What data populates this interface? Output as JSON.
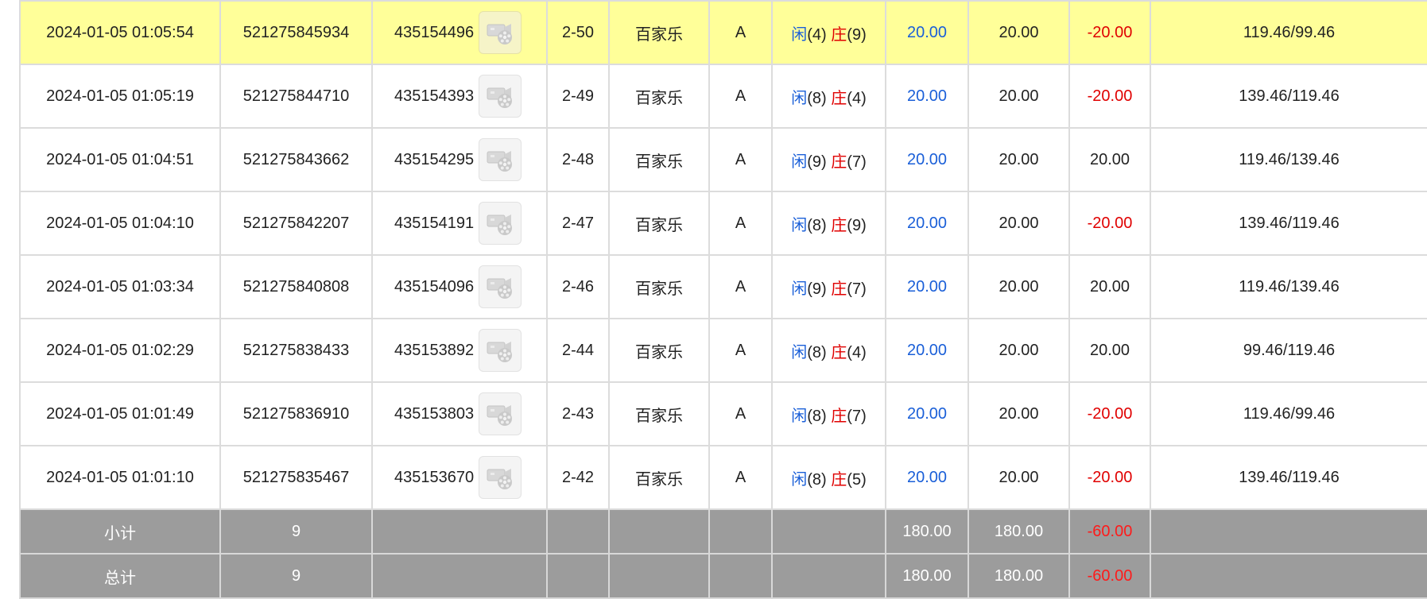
{
  "table": {
    "rows": [
      {
        "time": "2024-01-05 01:05:54",
        "order_id": "521275845934",
        "round_id": "435154496",
        "table_no": "2-50",
        "game": "百家乐",
        "type": "A",
        "player_label": "闲",
        "player_points": "(4)",
        "banker_label": "庄",
        "banker_points": "(9)",
        "bet": "20.00",
        "valid_bet": "20.00",
        "win_loss": "-20.00",
        "win_loss_color": "red",
        "balance": "119.46/99.46",
        "highlighted": true
      },
      {
        "time": "2024-01-05 01:05:19",
        "order_id": "521275844710",
        "round_id": "435154393",
        "table_no": "2-49",
        "game": "百家乐",
        "type": "A",
        "player_label": "闲",
        "player_points": "(8)",
        "banker_label": "庄",
        "banker_points": "(4)",
        "bet": "20.00",
        "valid_bet": "20.00",
        "win_loss": "-20.00",
        "win_loss_color": "red",
        "balance": "139.46/119.46",
        "highlighted": false
      },
      {
        "time": "2024-01-05 01:04:51",
        "order_id": "521275843662",
        "round_id": "435154295",
        "table_no": "2-48",
        "game": "百家乐",
        "type": "A",
        "player_label": "闲",
        "player_points": "(9)",
        "banker_label": "庄",
        "banker_points": "(7)",
        "bet": "20.00",
        "valid_bet": "20.00",
        "win_loss": "20.00",
        "win_loss_color": "black",
        "balance": "119.46/139.46",
        "highlighted": false
      },
      {
        "time": "2024-01-05 01:04:10",
        "order_id": "521275842207",
        "round_id": "435154191",
        "table_no": "2-47",
        "game": "百家乐",
        "type": "A",
        "player_label": "闲",
        "player_points": "(8)",
        "banker_label": "庄",
        "banker_points": "(9)",
        "bet": "20.00",
        "valid_bet": "20.00",
        "win_loss": "-20.00",
        "win_loss_color": "red",
        "balance": "139.46/119.46",
        "highlighted": false
      },
      {
        "time": "2024-01-05 01:03:34",
        "order_id": "521275840808",
        "round_id": "435154096",
        "table_no": "2-46",
        "game": "百家乐",
        "type": "A",
        "player_label": "闲",
        "player_points": "(9)",
        "banker_label": "庄",
        "banker_points": "(7)",
        "bet": "20.00",
        "valid_bet": "20.00",
        "win_loss": "20.00",
        "win_loss_color": "black",
        "balance": "119.46/139.46",
        "highlighted": false
      },
      {
        "time": "2024-01-05 01:02:29",
        "order_id": "521275838433",
        "round_id": "435153892",
        "table_no": "2-44",
        "game": "百家乐",
        "type": "A",
        "player_label": "闲",
        "player_points": "(8)",
        "banker_label": "庄",
        "banker_points": "(4)",
        "bet": "20.00",
        "valid_bet": "20.00",
        "win_loss": "20.00",
        "win_loss_color": "black",
        "balance": "99.46/119.46",
        "highlighted": false
      },
      {
        "time": "2024-01-05 01:01:49",
        "order_id": "521275836910",
        "round_id": "435153803",
        "table_no": "2-43",
        "game": "百家乐",
        "type": "A",
        "player_label": "闲",
        "player_points": "(8)",
        "banker_label": "庄",
        "banker_points": "(7)",
        "bet": "20.00",
        "valid_bet": "20.00",
        "win_loss": "-20.00",
        "win_loss_color": "red",
        "balance": "119.46/99.46",
        "highlighted": false
      },
      {
        "time": "2024-01-05 01:01:10",
        "order_id": "521275835467",
        "round_id": "435153670",
        "table_no": "2-42",
        "game": "百家乐",
        "type": "A",
        "player_label": "闲",
        "player_points": "(8)",
        "banker_label": "庄",
        "banker_points": "(5)",
        "bet": "20.00",
        "valid_bet": "20.00",
        "win_loss": "-20.00",
        "win_loss_color": "red",
        "balance": "139.46/119.46",
        "highlighted": false
      }
    ],
    "subtotal": {
      "label": "小计",
      "count": "9",
      "bet": "180.00",
      "valid_bet": "180.00",
      "win_loss": "-60.00"
    },
    "total": {
      "label": "总计",
      "count": "9",
      "bet": "180.00",
      "valid_bet": "180.00",
      "win_loss": "-60.00"
    }
  },
  "colors": {
    "highlight_row": "#ffff99",
    "summary_bg": "#9c9c9c",
    "player_blue": "#1a5fd8",
    "banker_red": "#e00000",
    "loss_red": "#e00000"
  },
  "icons": {
    "replay": "video-replay-icon"
  }
}
